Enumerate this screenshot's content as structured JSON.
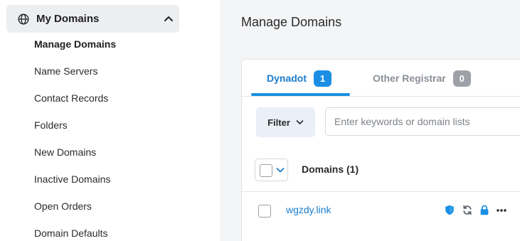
{
  "sidebar": {
    "section_title": "My Domains",
    "items": [
      {
        "label": "Manage Domains",
        "active": true
      },
      {
        "label": "Name Servers"
      },
      {
        "label": "Contact Records"
      },
      {
        "label": "Folders"
      },
      {
        "label": "New Domains"
      },
      {
        "label": "Inactive Domains"
      },
      {
        "label": "Open Orders"
      },
      {
        "label": "Domain Defaults"
      }
    ]
  },
  "main": {
    "page_title": "Manage Domains",
    "tabs": [
      {
        "label": "Dynadot",
        "count": "1",
        "active": true
      },
      {
        "label": "Other Registrar",
        "count": "0"
      }
    ],
    "filter_label": "Filter",
    "search": {
      "placeholder": "Enter keywords or domain lists",
      "value": ""
    },
    "table": {
      "column_header": "Domains (1)",
      "rows": [
        {
          "domain": "wgzdy.link",
          "icons": [
            "shield-icon",
            "refresh-icon",
            "lock-icon",
            "more-icon"
          ]
        }
      ]
    }
  },
  "colors": {
    "accent": "#1a8fe3",
    "link": "#1a7ccc",
    "sidebar_header_bg": "#eceef1",
    "main_bg": "#f4f5f7",
    "inactive_badge": "#9ea2a8"
  }
}
